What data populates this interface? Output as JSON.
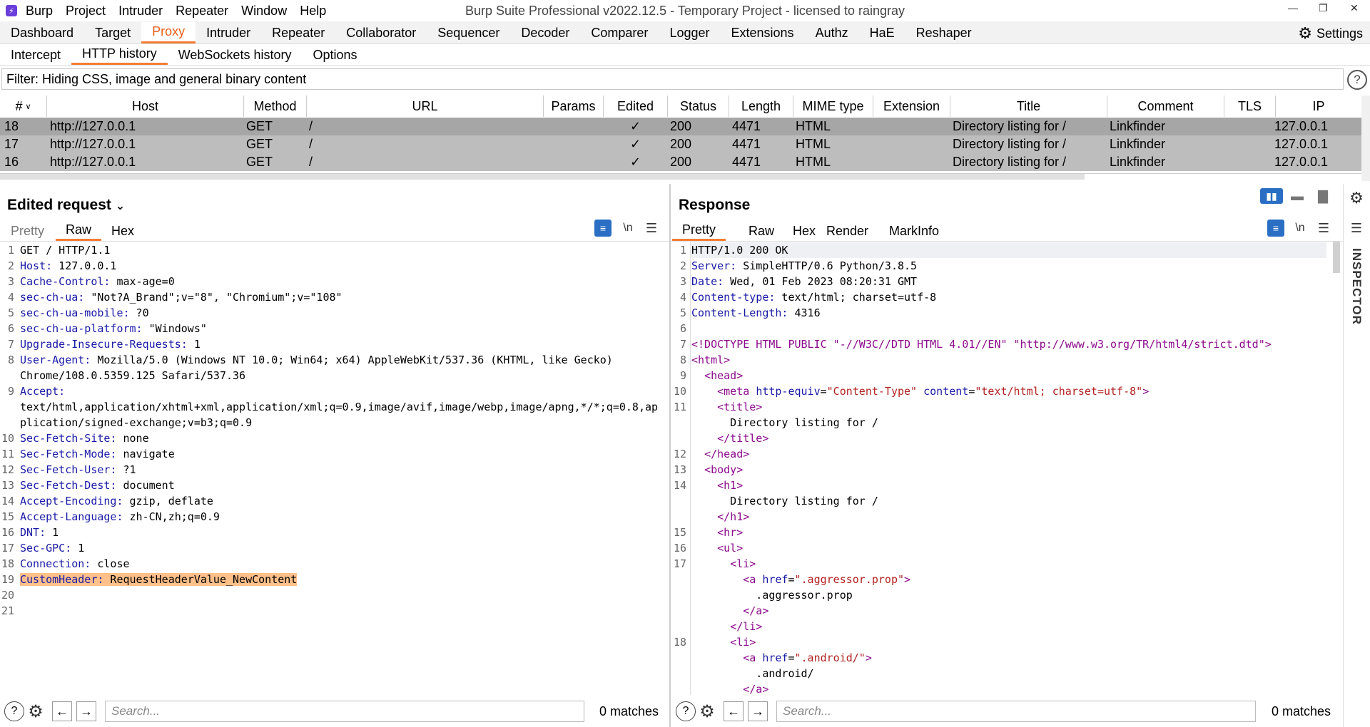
{
  "titlebar": {
    "menus": [
      "Burp",
      "Project",
      "Intruder",
      "Repeater",
      "Window",
      "Help"
    ],
    "title": "Burp Suite Professional v2022.12.5 - Temporary Project - licensed to raingray"
  },
  "tabs": [
    "Dashboard",
    "Target",
    "Proxy",
    "Intruder",
    "Repeater",
    "Collaborator",
    "Sequencer",
    "Decoder",
    "Comparer",
    "Logger",
    "Extensions",
    "Authz",
    "HaE",
    "Reshaper"
  ],
  "settings_label": "Settings",
  "subtabs": [
    "Intercept",
    "HTTP history",
    "WebSockets history",
    "Options"
  ],
  "filter": "Filter: Hiding CSS, image and general binary content",
  "table": {
    "headers": [
      "#",
      "Host",
      "Method",
      "URL",
      "Params",
      "Edited",
      "Status",
      "Length",
      "MIME type",
      "Extension",
      "Title",
      "Comment",
      "TLS",
      "IP"
    ],
    "rows": [
      {
        "id": "18",
        "host": "http://127.0.0.1",
        "method": "GET",
        "url": "/",
        "edited": "✓",
        "status": "200",
        "length": "4471",
        "mime": "HTML",
        "title": "Directory listing for /",
        "comment": "Linkfinder",
        "ip": "127.0.0.1"
      },
      {
        "id": "17",
        "host": "http://127.0.0.1",
        "method": "GET",
        "url": "/",
        "edited": "✓",
        "status": "200",
        "length": "4471",
        "mime": "HTML",
        "title": "Directory listing for /",
        "comment": "Linkfinder",
        "ip": "127.0.0.1"
      },
      {
        "id": "16",
        "host": "http://127.0.0.1",
        "method": "GET",
        "url": "/",
        "edited": "✓",
        "status": "200",
        "length": "4471",
        "mime": "HTML",
        "title": "Directory listing for /",
        "comment": "Linkfinder",
        "ip": "127.0.0.1"
      }
    ]
  },
  "request": {
    "title": "Edited request",
    "tabs": [
      "Pretty",
      "Raw",
      "Hex"
    ],
    "lines": [
      {
        "n": "1",
        "k": "",
        "v": "GET / HTTP/1.1"
      },
      {
        "n": "2",
        "k": "Host",
        "v": " 127.0.0.1"
      },
      {
        "n": "3",
        "k": "Cache-Control",
        "v": " max-age=0"
      },
      {
        "n": "4",
        "k": "sec-ch-ua",
        "v": " \"Not?A_Brand\";v=\"8\", \"Chromium\";v=\"108\""
      },
      {
        "n": "5",
        "k": "sec-ch-ua-mobile",
        "v": " ?0"
      },
      {
        "n": "6",
        "k": "sec-ch-ua-platform",
        "v": " \"Windows\""
      },
      {
        "n": "7",
        "k": "Upgrade-Insecure-Requests",
        "v": " 1"
      },
      {
        "n": "8",
        "k": "User-Agent",
        "v": " Mozilla/5.0 (Windows NT 10.0; Win64; x64) AppleWebKit/537.36 (KHTML, like Gecko)"
      },
      {
        "n": "",
        "k": "",
        "v": "Chrome/108.0.5359.125 Safari/537.36"
      },
      {
        "n": "9",
        "k": "Accept",
        "v": ""
      },
      {
        "n": "",
        "k": "",
        "v": "text/html,application/xhtml+xml,application/xml;q=0.9,image/avif,image/webp,image/apng,*/*;q=0.8,ap"
      },
      {
        "n": "",
        "k": "",
        "v": "plication/signed-exchange;v=b3;q=0.9"
      },
      {
        "n": "10",
        "k": "Sec-Fetch-Site",
        "v": " none"
      },
      {
        "n": "11",
        "k": "Sec-Fetch-Mode",
        "v": " navigate"
      },
      {
        "n": "12",
        "k": "Sec-Fetch-User",
        "v": " ?1"
      },
      {
        "n": "13",
        "k": "Sec-Fetch-Dest",
        "v": " document"
      },
      {
        "n": "14",
        "k": "Accept-Encoding",
        "v": " gzip, deflate"
      },
      {
        "n": "15",
        "k": "Accept-Language",
        "v": " zh-CN,zh;q=0.9"
      },
      {
        "n": "16",
        "k": "DNT",
        "v": " 1"
      },
      {
        "n": "17",
        "k": "Sec-GPC",
        "v": " 1"
      },
      {
        "n": "18",
        "k": "Connection",
        "v": " close"
      },
      {
        "n": "19",
        "k": "CustomHeader",
        "v": " RequestHeaderValue_NewContent",
        "hl": true
      },
      {
        "n": "20",
        "k": "",
        "v": ""
      },
      {
        "n": "21",
        "k": "",
        "v": ""
      }
    ],
    "search_placeholder": "Search...",
    "matches": "0 matches"
  },
  "response": {
    "title": "Response",
    "tabs": [
      "Pretty",
      "Raw",
      "Hex",
      "Render",
      "MarkInfo"
    ],
    "lines": [
      {
        "n": "1",
        "h": "HTTP/1.0 200 OK"
      },
      {
        "n": "2",
        "h": "<span class=\"k\">Server:</span> SimpleHTTP/0.6 Python/3.8.5"
      },
      {
        "n": "3",
        "h": "<span class=\"k\">Date:</span> Wed, 01 Feb 2023 08:20:31 GMT"
      },
      {
        "n": "4",
        "h": "<span class=\"k\">Content-type:</span> text/html; charset=utf-8"
      },
      {
        "n": "5",
        "h": "<span class=\"k\">Content-Length:</span> 4316"
      },
      {
        "n": "6",
        "h": ""
      },
      {
        "n": "7",
        "h": "<span class=\"tag\">&lt;!DOCTYPE HTML PUBLIC \"-//W3C//DTD HTML 4.01//EN\" \"http://www.w3.org/TR/html4/strict.dtd\"&gt;</span>"
      },
      {
        "n": "8",
        "h": "<span class=\"tag\">&lt;html&gt;</span>"
      },
      {
        "n": "9",
        "h": "  <span class=\"tag\">&lt;head&gt;</span>"
      },
      {
        "n": "10",
        "h": "    <span class=\"tag\">&lt;meta</span> <span class=\"attr\">http-equiv</span>=<span class=\"str\">\"Content-Type\"</span> <span class=\"attr\">content</span>=<span class=\"str\">\"text/html; charset=utf-8\"</span><span class=\"tag\">&gt;</span>"
      },
      {
        "n": "11",
        "h": "    <span class=\"tag\">&lt;title&gt;</span>"
      },
      {
        "n": "",
        "h": "      Directory listing for /"
      },
      {
        "n": "",
        "h": "    <span class=\"tag\">&lt;/title&gt;</span>"
      },
      {
        "n": "12",
        "h": "  <span class=\"tag\">&lt;/head&gt;</span>"
      },
      {
        "n": "13",
        "h": "  <span class=\"tag\">&lt;body&gt;</span>"
      },
      {
        "n": "14",
        "h": "    <span class=\"tag\">&lt;h1&gt;</span>"
      },
      {
        "n": "",
        "h": "      Directory listing for /"
      },
      {
        "n": "",
        "h": "    <span class=\"tag\">&lt;/h1&gt;</span>"
      },
      {
        "n": "15",
        "h": "    <span class=\"tag\">&lt;hr&gt;</span>"
      },
      {
        "n": "16",
        "h": "    <span class=\"tag\">&lt;ul&gt;</span>"
      },
      {
        "n": "17",
        "h": "      <span class=\"tag\">&lt;li&gt;</span>"
      },
      {
        "n": "",
        "h": "        <span class=\"tag\">&lt;a</span> <span class=\"attr\">href</span>=<span class=\"str\">\".aggressor.prop\"</span><span class=\"tag\">&gt;</span>"
      },
      {
        "n": "",
        "h": "          .aggressor.prop"
      },
      {
        "n": "",
        "h": "        <span class=\"tag\">&lt;/a&gt;</span>"
      },
      {
        "n": "",
        "h": "      <span class=\"tag\">&lt;/li&gt;</span>"
      },
      {
        "n": "18",
        "h": "      <span class=\"tag\">&lt;li&gt;</span>"
      },
      {
        "n": "",
        "h": "        <span class=\"tag\">&lt;a</span> <span class=\"attr\">href</span>=<span class=\"str\">\".android/\"</span><span class=\"tag\">&gt;</span>"
      },
      {
        "n": "",
        "h": "          .android/"
      },
      {
        "n": "",
        "h": "        <span class=\"tag\">&lt;/a&gt;</span>"
      }
    ],
    "search_placeholder": "Search...",
    "matches": "0 matches"
  },
  "inspector_label": "INSPECTOR",
  "colors": {
    "accent": "#f47d30",
    "highlight": "#ffc08a",
    "selected_row": "#a6a6a6",
    "row": "#bdbdbd",
    "header_key": "#1a1aa6",
    "tag": "#8b0a8b"
  }
}
